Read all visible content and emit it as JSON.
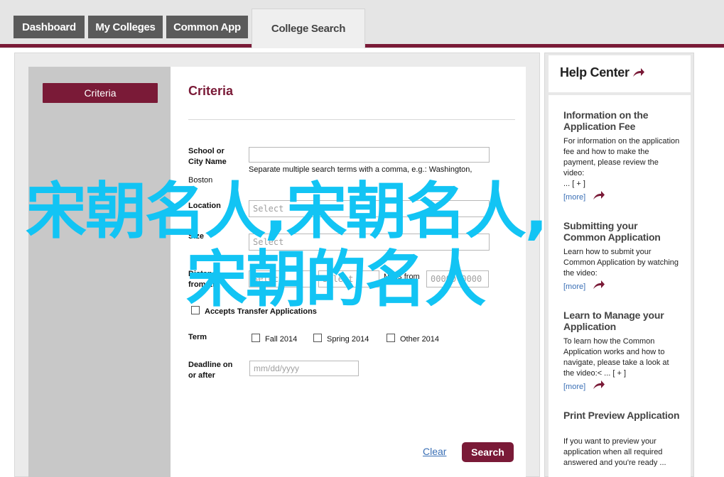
{
  "tabs": [
    {
      "label": "Dashboard"
    },
    {
      "label": "My Colleges"
    },
    {
      "label": "Common App"
    },
    {
      "label": "College Search"
    }
  ],
  "sidebar": {
    "criteria_button": "Criteria"
  },
  "form": {
    "title": "Criteria",
    "school_label": "School or City Name",
    "school_value": "",
    "school_hint": "Separate multiple search terms with a comma, e.g.: Washington,",
    "school_hint_2": "Boston",
    "location_label": "Location",
    "location_placeholder": "Select",
    "size_label": "Size",
    "size_placeholder": "Select",
    "distance_label": "Distance from ZIP",
    "distance_select": "Select",
    "distance_select_2": "Select",
    "miles_from": "Miles from",
    "zip_placeholder": "00000-0000",
    "accepts_transfer": "Accepts Transfer Applications",
    "term_label": "Term",
    "terms": [
      "Fall 2014",
      "Spring 2014",
      "Other 2014"
    ],
    "deadline_label": "Deadline on or after",
    "deadline_placeholder": "mm/dd/yyyy",
    "clear": "Clear",
    "search": "Search"
  },
  "help": {
    "title": "Help Center",
    "items": [
      {
        "title": "Information on the Application Fee",
        "text": "For information on the application fee and how to make the payment, please review the video:",
        "tail": "... [ + ]",
        "more": "[more]"
      },
      {
        "title": "Submitting your Common Application",
        "text": "Learn how to submit your Common Application by watching the video:",
        "tail": "... [ + ]",
        "more": "[more]"
      },
      {
        "title": "Learn to Manage your Application",
        "text": "To learn how the Common Application works and how to navigate, please take a look at the video:< ... [ + ]",
        "tail": "",
        "more": "[more]"
      },
      {
        "title": "Print Preview Application",
        "text": "If you want to preview your application when all required answered and you're ready ...",
        "tail": "",
        "more": ""
      }
    ]
  },
  "overlay": {
    "line1": "宋朝名人,宋朝名人,",
    "line2": "宋朝的名人"
  },
  "colors": {
    "brand": "#7a1a37",
    "overlay": "#12c4f4",
    "link": "#3a6fb5"
  }
}
